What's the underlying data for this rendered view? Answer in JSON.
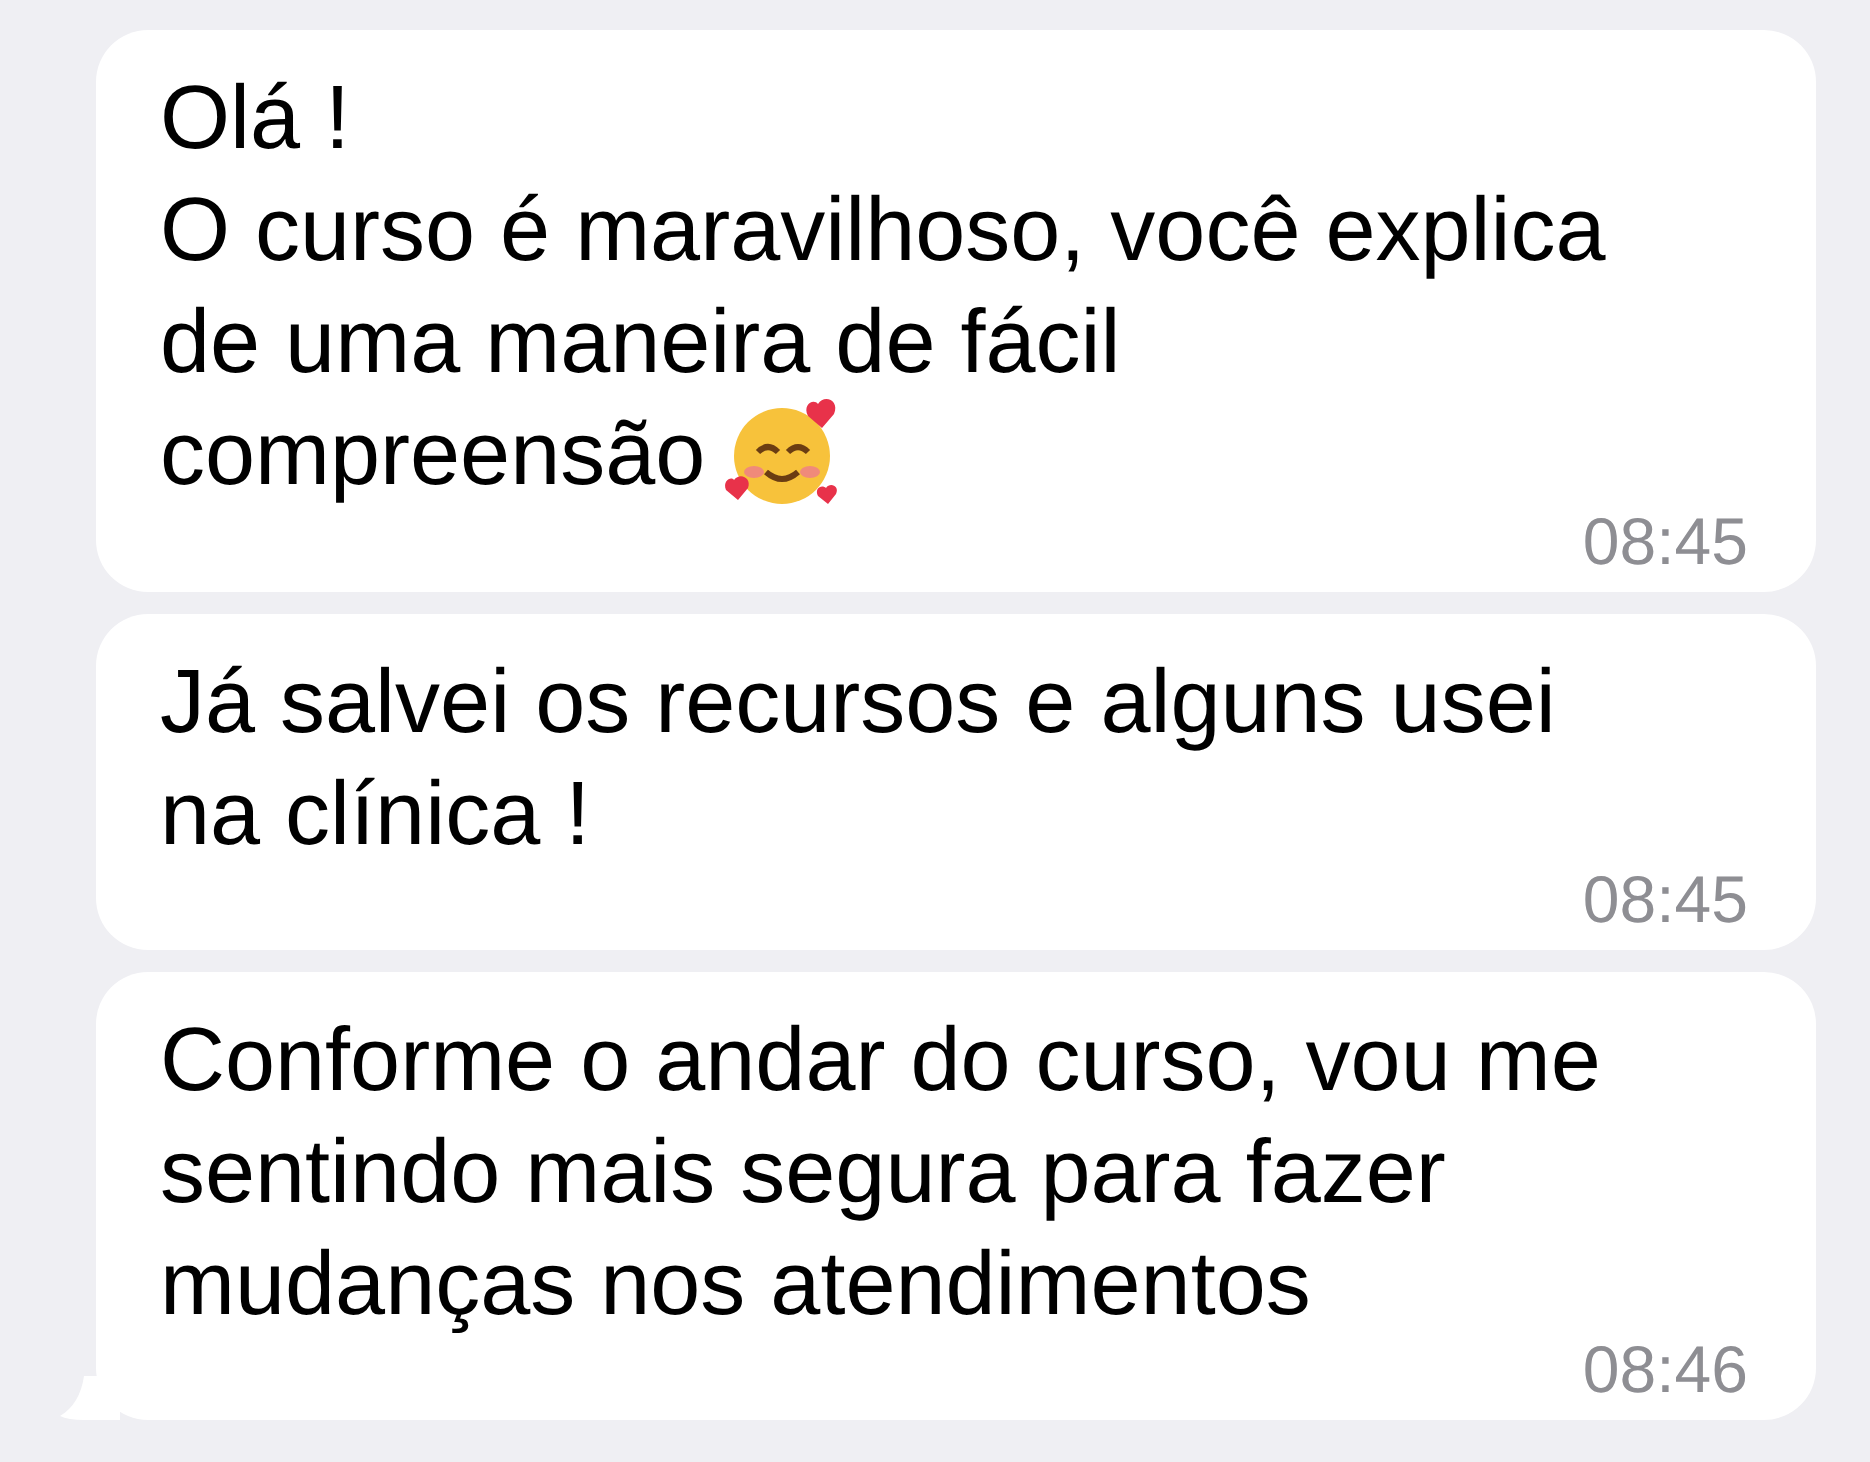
{
  "messages": [
    {
      "text": "Olá !\nO curso é maravilhoso, você explica\nde uma maneira de fácil\ncompreensão",
      "emoji": true,
      "time": "08:45",
      "tail": false
    },
    {
      "text": "Já salvei os recursos e alguns usei\nna clínica !",
      "emoji": false,
      "time": "08:45",
      "tail": false
    },
    {
      "text": "Conforme o andar do curso, vou me\nsentindo mais segura para fazer\nmudanças nos atendimentos",
      "emoji": false,
      "time": "08:46",
      "tail": true
    }
  ]
}
